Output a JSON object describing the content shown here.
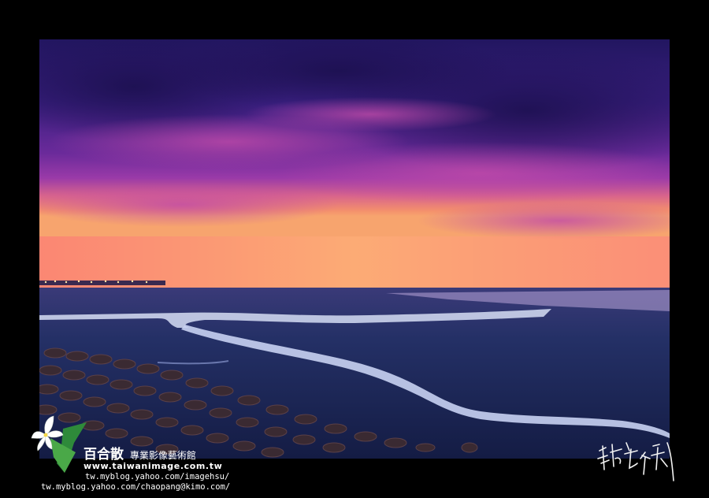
{
  "photo": {
    "subject": "",
    "colors": {
      "sky_top": "#2a1a6e",
      "sky_mid": "#7a2fa0",
      "horizon_glow": "#f08a6a",
      "mudflat": "#1f2a5a",
      "water": "#c9d4f0"
    }
  },
  "watermark": {
    "brand_name": "百合散",
    "brand_sub": "專業影像藝術館",
    "url_main": "www.taiwanimage.com.tw",
    "url_blog": "tw.myblog.yahoo.com/imagehsu/",
    "url_blog2": "tw.myblog.yahoo.com/chaopang@kimo.com/",
    "logo_icon": "lily-flower-icon"
  },
  "signature": {
    "text": "許影萍攝影"
  }
}
